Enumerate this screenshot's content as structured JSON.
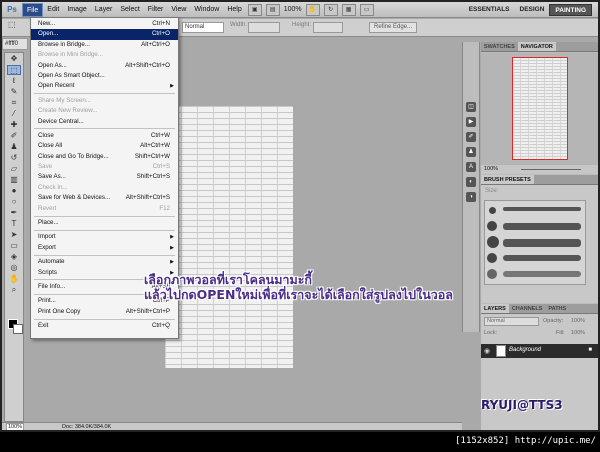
{
  "app": {
    "logo": "Ps"
  },
  "menubar": {
    "items": [
      "File",
      "Edit",
      "Image",
      "Layer",
      "Select",
      "Filter",
      "View",
      "Window",
      "Help"
    ],
    "zoom": "100%",
    "workspaces": [
      "ESSENTIALS",
      "DESIGN",
      "PAINTING"
    ],
    "active_workspace": "PAINTING"
  },
  "optbar": {
    "mode": "Normal",
    "width_label": "Width:",
    "height_label": "Height:",
    "refine_edge": "Refine Edge..."
  },
  "document_tab": {
    "label": "#ffff0"
  },
  "file_menu": {
    "items": [
      {
        "label": "New...",
        "shortcut": "Ctrl+N"
      },
      {
        "label": "Open...",
        "shortcut": "Ctrl+O",
        "highlight": true
      },
      {
        "label": "Browse in Bridge...",
        "shortcut": "Alt+Ctrl+O"
      },
      {
        "label": "Browse in Mini Bridge...",
        "shortcut": "",
        "disabled": true
      },
      {
        "label": "Open As...",
        "shortcut": "Alt+Shift+Ctrl+O"
      },
      {
        "label": "Open As Smart Object...",
        "shortcut": ""
      },
      {
        "label": "Open Recent",
        "shortcut": "",
        "submenu": true
      },
      {
        "sep": true
      },
      {
        "label": "Share My Screen...",
        "shortcut": "",
        "disabled": true
      },
      {
        "label": "Create New Review...",
        "shortcut": "",
        "disabled": true
      },
      {
        "label": "Device Central...",
        "shortcut": ""
      },
      {
        "sep": true
      },
      {
        "label": "Close",
        "shortcut": "Ctrl+W"
      },
      {
        "label": "Close All",
        "shortcut": "Alt+Ctrl+W"
      },
      {
        "label": "Close and Go To Bridge...",
        "shortcut": "Shift+Ctrl+W"
      },
      {
        "label": "Save",
        "shortcut": "Ctrl+S",
        "disabled": true
      },
      {
        "label": "Save As...",
        "shortcut": "Shift+Ctrl+S"
      },
      {
        "label": "Check In...",
        "shortcut": "",
        "disabled": true
      },
      {
        "label": "Save for Web & Devices...",
        "shortcut": "Alt+Shift+Ctrl+S"
      },
      {
        "label": "Revert",
        "shortcut": "F12",
        "disabled": true
      },
      {
        "sep": true
      },
      {
        "label": "Place...",
        "shortcut": ""
      },
      {
        "sep": true
      },
      {
        "label": "Import",
        "shortcut": "",
        "submenu": true
      },
      {
        "label": "Export",
        "shortcut": "",
        "submenu": true
      },
      {
        "sep": true
      },
      {
        "label": "Automate",
        "shortcut": "",
        "submenu": true
      },
      {
        "label": "Scripts",
        "shortcut": "",
        "submenu": true
      },
      {
        "sep": true
      },
      {
        "label": "File Info...",
        "shortcut": "Alt+Sh"
      },
      {
        "sep": true
      },
      {
        "label": "Print...",
        "shortcut": "Ctrl+P"
      },
      {
        "label": "Print One Copy",
        "shortcut": "Alt+Shift+Ctrl+P"
      },
      {
        "sep": true
      },
      {
        "label": "Exit",
        "shortcut": "Ctrl+Q"
      }
    ]
  },
  "panels": {
    "navigator_tabs": [
      "SWATCHES",
      "NAVIGATOR"
    ],
    "navigator_zoom": "100%",
    "brush_title": "BRUSH PRESETS",
    "brush_size_label": "Size:",
    "layers_tabs": [
      "LAYERS",
      "CHANNELS",
      "PATHS"
    ],
    "blend_mode": "Normal",
    "opacity_label": "Opacity:",
    "opacity_value": "100%",
    "lock_label": "Lock:",
    "fill_label": "Fill:",
    "fill_value": "100%",
    "layer_name": "Background"
  },
  "statusbar": {
    "zoom": "100%",
    "doc": "Doc: 384.0K/384.0K"
  },
  "caption": {
    "line1": "เลือกภาพวอลที่เราโคลนมามะกี้",
    "line2": "แล้วไปกดOPENใหม่เพื่อที่เราจะได้เลือกใส่รูปลงไปในวอล"
  },
  "signature": "RYUJI@TTS3",
  "footer_label": "[1152x852] http://upic.me/"
}
